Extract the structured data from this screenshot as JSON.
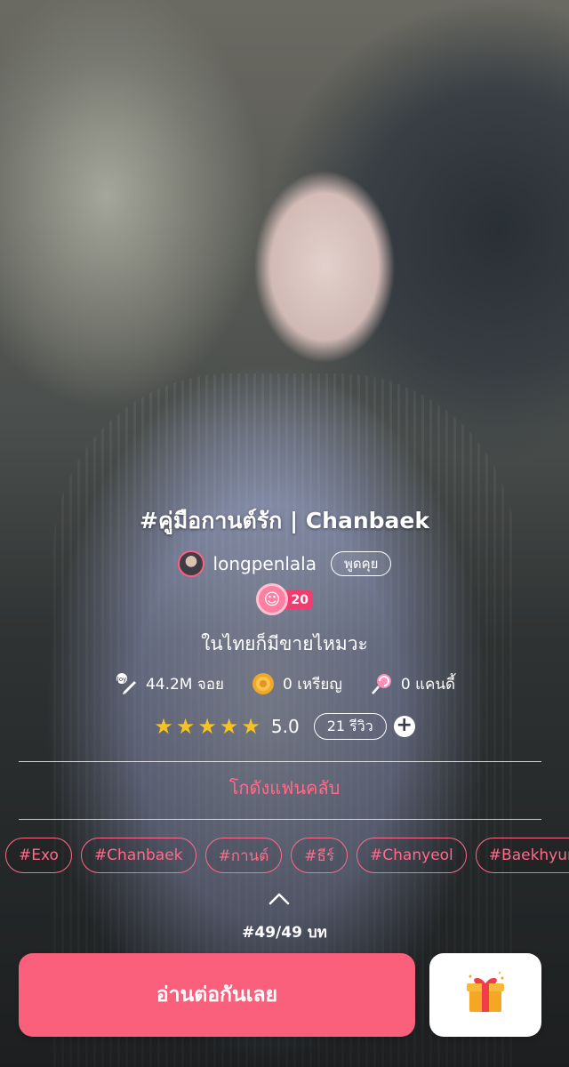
{
  "story": {
    "title": "#คู่มือกานต์รัก | Chanbaek",
    "author": "longpenlala",
    "chat_label": "พูดคุย",
    "level": "20",
    "subtitle": "ในไทยก็มีขายไหมวะ"
  },
  "stats": {
    "reads": "44.2M จอย",
    "coins": "0 เหรียญ",
    "candy": "0 แคนดี้"
  },
  "rating": {
    "stars": 5,
    "value": "5.0",
    "reviews_label": "21 รีวิว",
    "add_label": "+"
  },
  "fanclub_label": "โกดังแฟนคลับ",
  "tags": [
    "#Exo",
    "#Chanbaek",
    "#กานต์",
    "#ธีร์",
    "#Chanyeol",
    "#Baekhyun"
  ],
  "chapter_count": "#49/49 บท",
  "read_button_label": "อ่านต่อกันเลย",
  "colors": {
    "accent": "#fa5f7b",
    "tag_pink": "#ff6b8a",
    "star": "#f5c123"
  },
  "icons": {
    "reads": "pen-joy-icon",
    "coins": "coin-icon",
    "candy": "lollipop-icon",
    "gift": "gift-box-icon"
  }
}
